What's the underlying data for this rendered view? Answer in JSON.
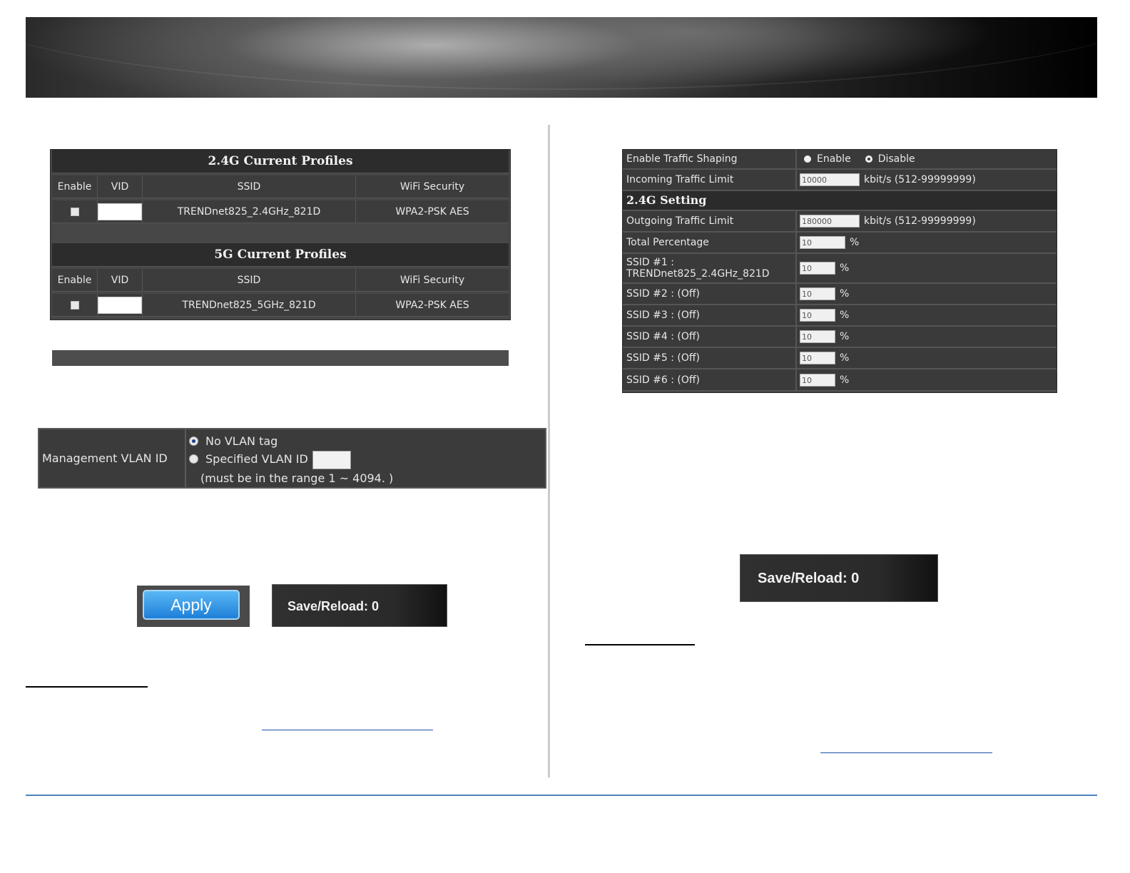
{
  "profiles_24g": {
    "title": "2.4G Current Profiles",
    "headers": {
      "enable": "Enable",
      "vid": "VID",
      "ssid": "SSID",
      "security": "WiFi Security"
    },
    "row": {
      "ssid": "TRENDnet825_2.4GHz_821D",
      "security": "WPA2-PSK AES",
      "enabled": false
    }
  },
  "profiles_5g": {
    "title": "5G Current Profiles",
    "headers": {
      "enable": "Enable",
      "vid": "VID",
      "ssid": "SSID",
      "security": "WiFi Security"
    },
    "row": {
      "ssid": "TRENDnet825_5GHz_821D",
      "security": "WPA2-PSK AES",
      "enabled": false
    }
  },
  "management_vlan": {
    "label": "Management VLAN ID",
    "option_no_tag": "No VLAN tag",
    "option_specified": "Specified VLAN ID",
    "range_note": "(must be in the range 1 ~ 4094. )",
    "selected": "No VLAN tag"
  },
  "buttons": {
    "apply": "Apply",
    "save_reload_left": "Save/Reload: 0",
    "save_reload_right": "Save/Reload: 0"
  },
  "traffic_shaping": {
    "enable_label": "Enable Traffic Shaping",
    "opt_enable": "Enable",
    "opt_disable": "Disable",
    "selected": "Disable",
    "incoming_label": "Incoming Traffic Limit",
    "incoming_value": "10000",
    "incoming_unit": "kbit/s (512-99999999)",
    "section_24g": "2.4G Setting",
    "outgoing_label": "Outgoing Traffic Limit",
    "outgoing_value": "180000",
    "outgoing_unit": "kbit/s (512-99999999)",
    "total_label": "Total Percentage",
    "total_value": "10",
    "percent": "%",
    "ssids": [
      {
        "label": "SSID #1 :",
        "sublabel": "TRENDnet825_2.4GHz_821D",
        "value": "10"
      },
      {
        "label": "SSID #2 : (Off)",
        "value": "10"
      },
      {
        "label": "SSID #3 : (Off)",
        "value": "10"
      },
      {
        "label": "SSID #4 : (Off)",
        "value": "10"
      },
      {
        "label": "SSID #5 : (Off)",
        "value": "10"
      },
      {
        "label": "SSID #6 : (Off)",
        "value": "10"
      }
    ]
  },
  "colors": {
    "divider": "#c8cbd0",
    "bottom_rule": "#4f81bd",
    "apply_blue": "#1e7fd8"
  }
}
